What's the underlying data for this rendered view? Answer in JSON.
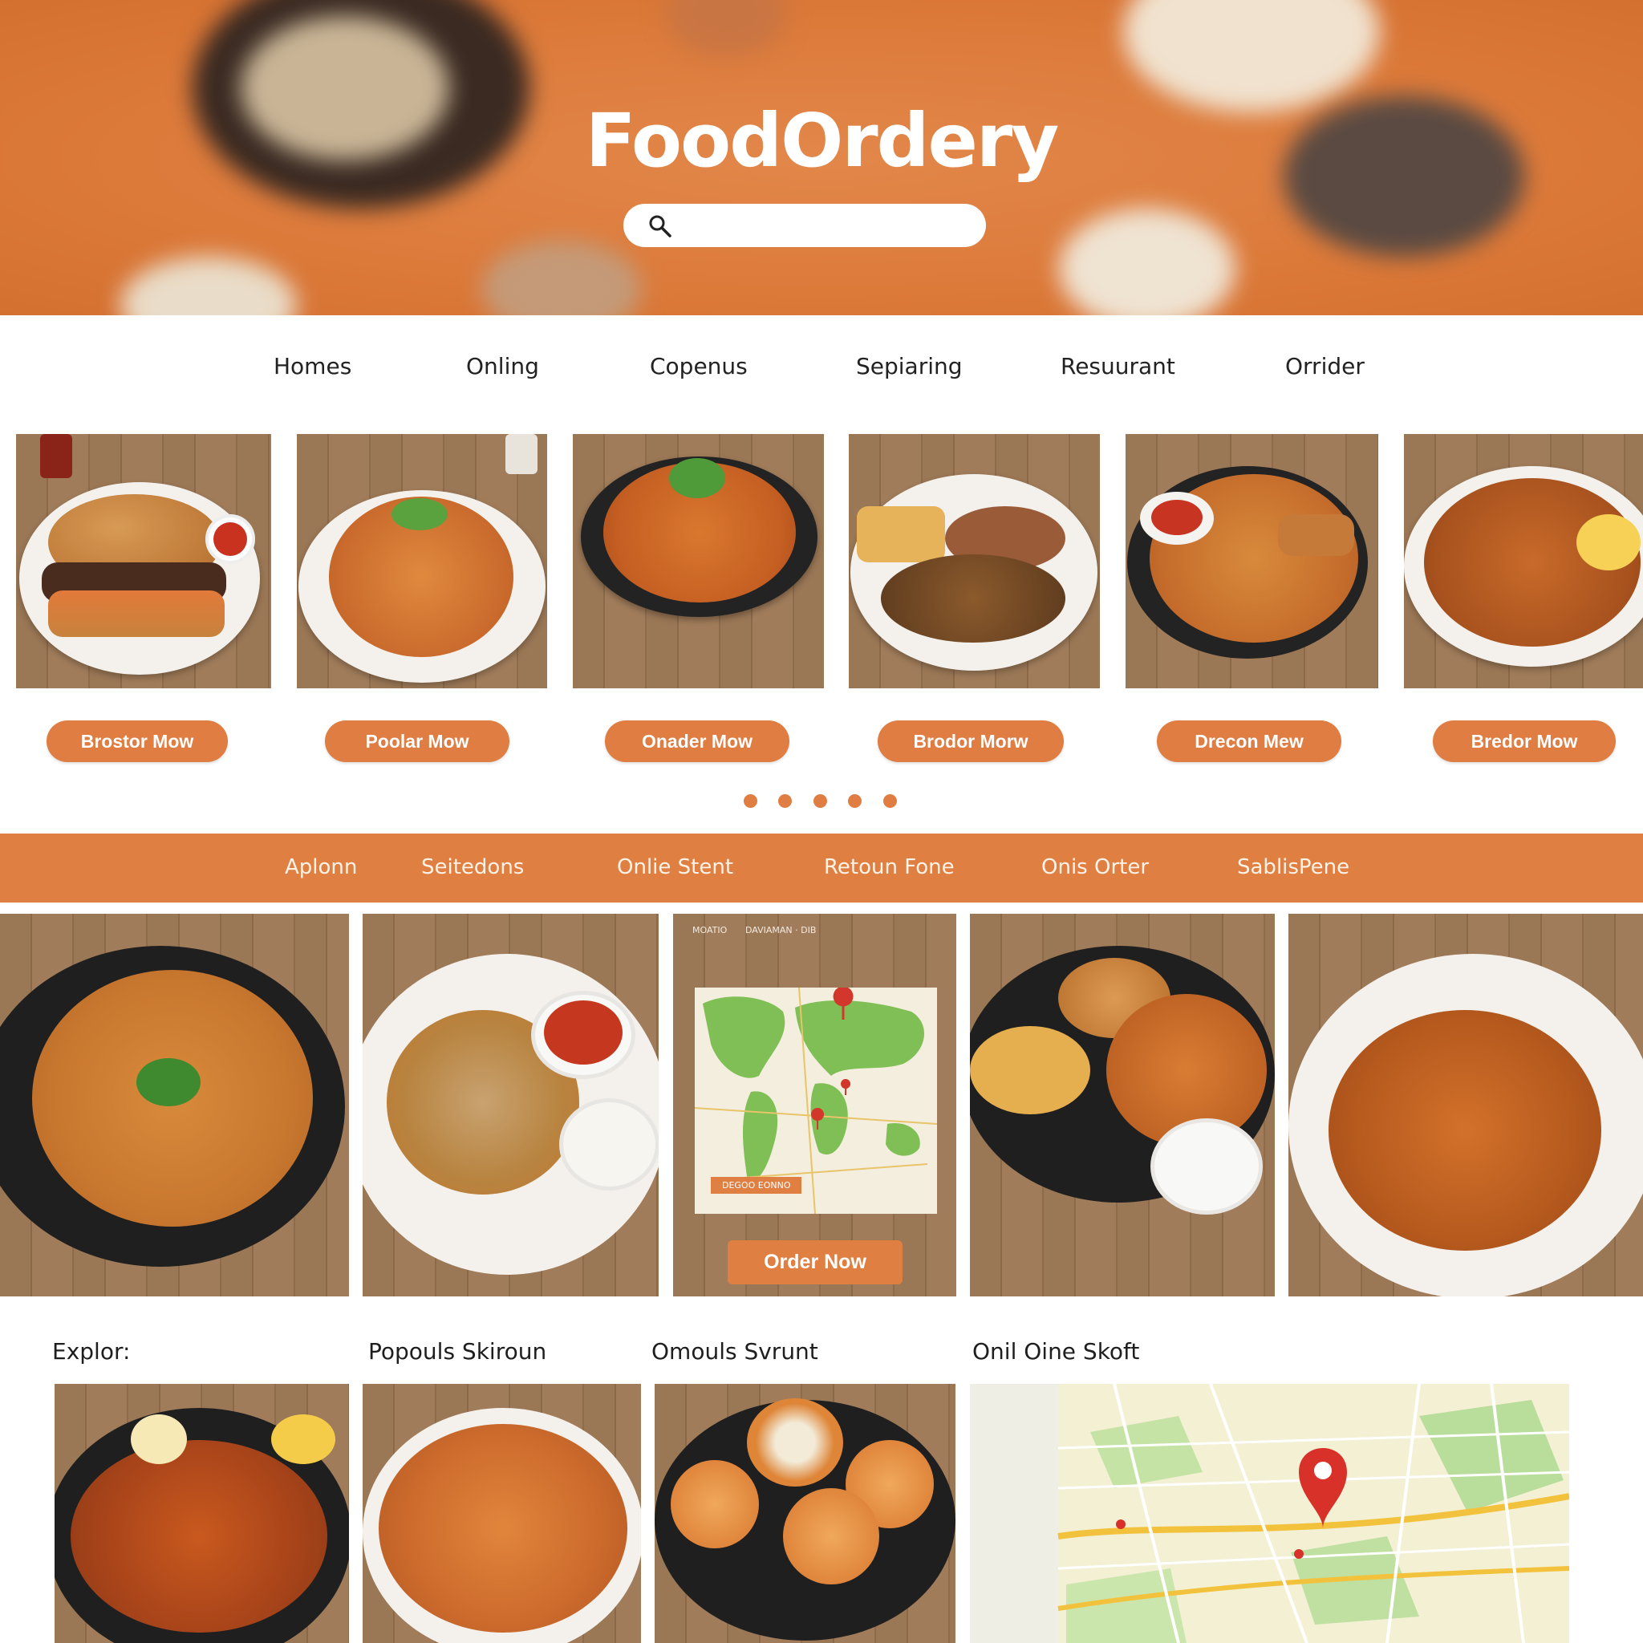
{
  "brand": {
    "logo_text": "FoodOrdery",
    "accent_color": "#df7d42"
  },
  "search": {
    "icon": "search-icon",
    "placeholder": "",
    "value": ""
  },
  "top_nav": {
    "items": [
      {
        "label": "Homes"
      },
      {
        "label": "Onling"
      },
      {
        "label": "Copenus"
      },
      {
        "label": "Sepiaring"
      },
      {
        "label": "Resuurant"
      },
      {
        "label": "Orrider"
      }
    ]
  },
  "carousel": {
    "cards": [
      {
        "dish": "burger",
        "button_label": "Brostor Mow"
      },
      {
        "dish": "fried-rice",
        "button_label": "Poolar Mow"
      },
      {
        "dish": "noodles-skillet",
        "button_label": "Onader Mow"
      },
      {
        "dish": "fish-fries",
        "button_label": "Brodor Morw"
      },
      {
        "dish": "stir-fry-skillet",
        "button_label": "Drecon Mew"
      },
      {
        "dish": "noodles-lemon",
        "button_label": "Bredor Mow"
      }
    ],
    "page_dots": 5
  },
  "category_bar": {
    "items": [
      {
        "label": "Aplonn"
      },
      {
        "label": "Seitedons"
      },
      {
        "label": "Onlie Stent"
      },
      {
        "label": "Retoun Fone"
      },
      {
        "label": "Onis Orter"
      },
      {
        "label": "SablisPene"
      }
    ]
  },
  "featured": {
    "map_card": {
      "top_text_a": "MOATIO",
      "top_text_b": "DAVIAMAN · DIB",
      "map_chip": "DEGOO EONNO",
      "button_label": "Order Now"
    }
  },
  "sections": [
    {
      "heading": "Explor:"
    },
    {
      "heading": "Popouls Skiroun"
    },
    {
      "heading": "Omouls Svrunt"
    },
    {
      "heading": "Onil Oine Skoft"
    }
  ]
}
